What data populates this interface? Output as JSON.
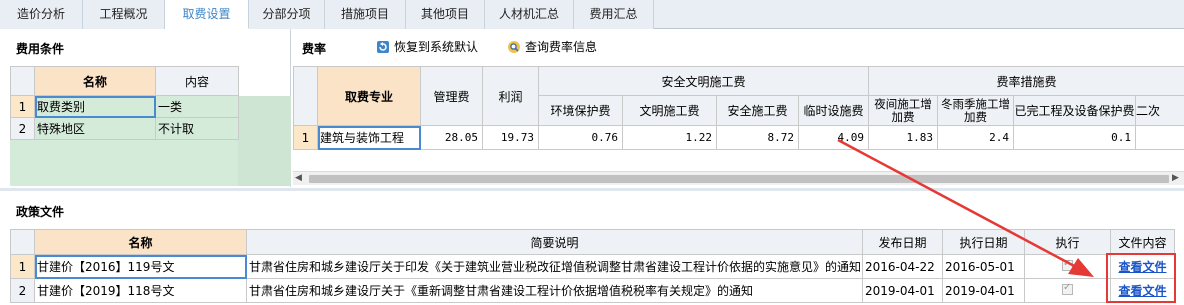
{
  "tabs": [
    "造价分析",
    "工程概况",
    "取费设置",
    "分部分项",
    "措施项目",
    "其他项目",
    "人材机汇总",
    "费用汇总"
  ],
  "active_tab": "取费设置",
  "conditions": {
    "title": "费用条件",
    "col_name": "名称",
    "col_content": "内容",
    "rows": [
      {
        "num": "1",
        "name": "取费类别",
        "value": "一类"
      },
      {
        "num": "2",
        "name": "特殊地区",
        "value": "不计取"
      }
    ]
  },
  "rate": {
    "title": "费率",
    "restore_label": "恢复到系统默认",
    "query_label": "查询费率信息",
    "headers": {
      "major": "取费专业",
      "mgmt": "管理费",
      "profit": "利润",
      "safety_group": "安全文明施工费",
      "env": "环境保护费",
      "civil": "文明施工费",
      "safe": "安全施工费",
      "temp": "临时设施费",
      "measure_group": "费率措施费",
      "night": "夜间施工增加费",
      "winter": "冬雨季施工增加费",
      "protect": "已完工程及设备保护费",
      "second": "二次"
    },
    "row": {
      "num": "1",
      "major": "建筑与装饰工程",
      "mgmt": "28.05",
      "profit": "19.73",
      "env": "0.76",
      "civil": "1.22",
      "safe": "8.72",
      "temp": "4.09",
      "night": "1.83",
      "winter": "2.4",
      "protect": "0.1"
    }
  },
  "policy": {
    "title": "政策文件",
    "headers": {
      "name": "名称",
      "desc": "简要说明",
      "pub": "发布日期",
      "exec": "执行日期",
      "run": "执行",
      "file": "文件内容"
    },
    "rows": [
      {
        "num": "1",
        "name": "甘建价【2016】119号文",
        "desc": "甘肃省住房和城乡建设厅关于印发《关于建筑业营业税改征增值税调整甘肃省建设工程计价依据的实施意见》的通知",
        "pub": "2016-04-22",
        "exec": "2016-05-01",
        "file": "查看文件"
      },
      {
        "num": "2",
        "name": "甘建价【2019】118号文",
        "desc": "甘肃省住房和城乡建设厅关于《重新调整甘肃省建设工程计价依据增值税税率有关规定》的通知",
        "pub": "2019-04-01",
        "exec": "2019-04-01",
        "file": "查看文件"
      }
    ]
  },
  "colors": {
    "accent": "#3f86c8",
    "annotation": "#e53935",
    "link": "#1a55c8"
  }
}
